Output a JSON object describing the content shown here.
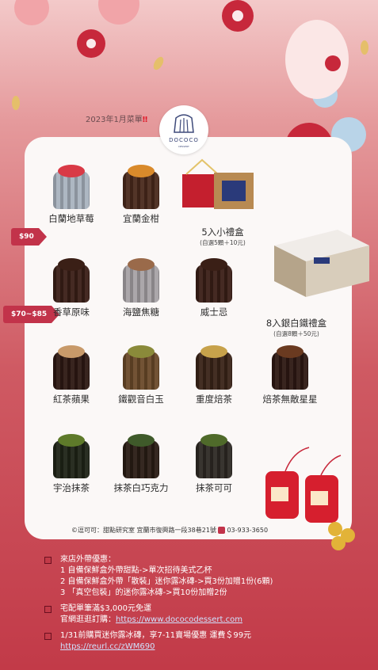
{
  "header": {
    "month_text": "2023年1月菜單",
    "month_mark": "‼",
    "logo_text": "DOCOCO",
    "logo_sub": "DESSERT"
  },
  "price_tags": [
    {
      "text": "$90"
    },
    {
      "text": "$70~$85"
    }
  ],
  "items": [
    {
      "label": "白蘭地草莓",
      "top_color": "#d93a46",
      "body_color": "#a9b3bf"
    },
    {
      "label": "宜蘭金柑",
      "top_color": "#d98a2b",
      "body_color": "#4a2a1c"
    },
    {
      "label": "香草原味",
      "top_color": "#3a1f16",
      "body_color": "#3b1f17"
    },
    {
      "label": "海鹽焦糖",
      "top_color": "#9a6a4a",
      "body_color": "#a7a2a6"
    },
    {
      "label": "威士忌",
      "top_color": "#3a1f16",
      "body_color": "#3b1f17"
    },
    {
      "label": "紅茶蘋果",
      "top_color": "#c89a6a",
      "body_color": "#2e1913"
    },
    {
      "label": "鐵觀音白玉",
      "top_color": "#8a8a3a",
      "body_color": "#6b4a2a"
    },
    {
      "label": "重度焙茶",
      "top_color": "#c7a24b",
      "body_color": "#3a2418"
    },
    {
      "label": "焙茶無敵星星",
      "top_color": "#6a3a20",
      "body_color": "#2e1913"
    },
    {
      "label": "宇治抹茶",
      "top_color": "#5e7a2a",
      "body_color": "#1f2417"
    },
    {
      "label": "抹茶白巧克力",
      "top_color": "#3f5a2a",
      "body_color": "#2a1d15"
    },
    {
      "label": "抹茶可可",
      "top_color": "#4f6a2a",
      "body_color": "#2e2a25"
    }
  ],
  "gifts": [
    {
      "name": "5入小禮盒",
      "note": "(自選5顆＋10元)"
    },
    {
      "name": "8入銀白鐵禮盒",
      "note": "(自選8顆＋50元)"
    }
  ],
  "footer": {
    "shop": "©逗可可：甜點研究室",
    "address": "宜蘭市復興路一段38巷21號",
    "phone": "03-933-3650"
  },
  "notes": [
    {
      "lines": [
        {
          "text": "來店外帶優惠："
        },
        {
          "text": "1 自備保鮮盒外帶甜點->單次招待美式乙杯"
        },
        {
          "text": "2 自備保鮮盒外帶「散裝」迷你露冰磚->買3份加贈1份(6顆)"
        },
        {
          "text": "3 「真空包裝」的迷你露冰磚->買10份加贈2份"
        }
      ]
    },
    {
      "lines": [
        {
          "text": "宅配單筆滿$3,000元免運"
        },
        {
          "text": "官網逛逛訂購：",
          "link": "https://www.dococodessert.com"
        }
      ]
    },
    {
      "lines": [
        {
          "text": "1/31前購買迷你露冰磚，享7-11賣場優惠 運費＄99元"
        },
        {
          "link": "https://reurl.cc/zWM690"
        }
      ]
    }
  ],
  "colors": {
    "accent": "#c2334a",
    "card": "#fbf8f7"
  }
}
